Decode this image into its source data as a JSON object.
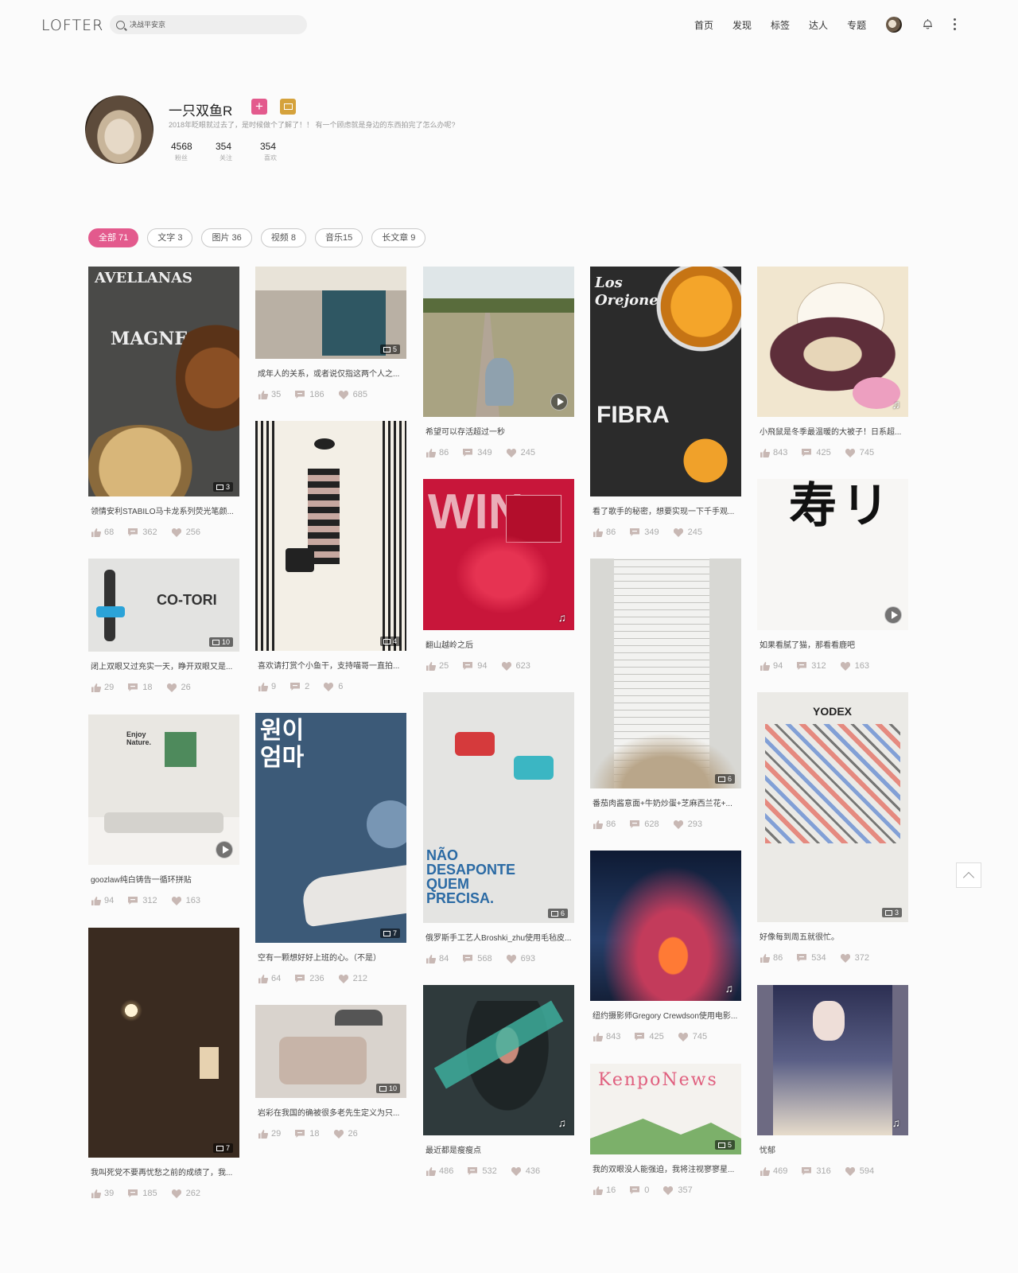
{
  "header": {
    "logo": "LOFTER",
    "search_placeholder": "决战平安京",
    "nav": [
      "首页",
      "发现",
      "标签",
      "达人",
      "专题"
    ]
  },
  "profile": {
    "name": "一只双鱼R",
    "follow_label": "+",
    "bio": "2018年眨眼就过去了，是时候做个了解了！！ 有一个顾虑就是身边的东西拍完了怎么办呢?",
    "stats": [
      {
        "num": "4568",
        "label": "粉丝"
      },
      {
        "num": "354",
        "label": "关注"
      },
      {
        "num": "354",
        "label": "喜欢"
      }
    ]
  },
  "tabs": [
    {
      "label": "全部  71",
      "active": true
    },
    {
      "label": "文字  3"
    },
    {
      "label": "图片 36"
    },
    {
      "label": "视频 8"
    },
    {
      "label": "音乐15"
    },
    {
      "label": "长文章 9"
    }
  ],
  "cards": [
    {
      "title": "领情安利STABILO马卡龙系列荧光笔颜...",
      "likes": "68",
      "comments": "362",
      "hearts": "256",
      "badge": "3",
      "kind": "image",
      "color": "#4a4a48"
    },
    {
      "title": "闭上双眼又过充实一天，睁开双眼又是...",
      "likes": "29",
      "comments": "18",
      "hearts": "26",
      "badge": "10",
      "kind": "image",
      "color": "#e3e3e1"
    },
    {
      "title": "goozlaw纯白铸告一循环拼贴",
      "likes": "94",
      "comments": "312",
      "hearts": "163",
      "kind": "video",
      "color": "#e9e7e2"
    },
    {
      "title": "我叫死党不要再忧愁之前的成绩了，我...",
      "likes": "39",
      "comments": "185",
      "hearts": "262",
      "badge": "7",
      "kind": "image",
      "color": "#3a2b20"
    },
    {
      "title": "成年人的关系，或者说仅指这两个人之...",
      "likes": "35",
      "comments": "186",
      "hearts": "685",
      "badge": "5",
      "kind": "image",
      "color": "#b9b0a4"
    },
    {
      "title": "喜欢请打赏个小鱼干，支持喵哥一直拍...",
      "likes": "9",
      "comments": "2",
      "hearts": "6",
      "badge": "4",
      "kind": "image",
      "color": "#f3efe6"
    },
    {
      "title": "空有一颗想好好上班的心。（不是）",
      "likes": "64",
      "comments": "236",
      "hearts": "212",
      "badge": "7",
      "kind": "image",
      "color": "#3c5a78"
    },
    {
      "title": "岩彩在我国的确被很多老先生定义为只...",
      "likes": "29",
      "comments": "18",
      "hearts": "26",
      "badge": "10",
      "kind": "image",
      "color": "#d9d3cd"
    },
    {
      "title": "希望可以存活超过一秒",
      "likes": "86",
      "comments": "349",
      "hearts": "245",
      "kind": "video",
      "color": "#a9a382"
    },
    {
      "title": "翻山越岭之后",
      "likes": "25",
      "comments": "94",
      "hearts": "623",
      "kind": "music",
      "color": "#c8163a"
    },
    {
      "title": "俄罗斯手工艺人Broshki_zhu使用毛毡皮...",
      "likes": "84",
      "comments": "568",
      "hearts": "693",
      "badge": "6",
      "kind": "image",
      "color": "#e4e4e2"
    },
    {
      "title": "最近都是瘦瘦点",
      "likes": "486",
      "comments": "532",
      "hearts": "436",
      "kind": "music",
      "color": "#2f3a3c"
    },
    {
      "title": "看了歌手的秘密，想要实现一下千手观...",
      "likes": "86",
      "comments": "349",
      "hearts": "245",
      "kind": "none",
      "color": "#2b2b2b"
    },
    {
      "title": "番茄肉酱意面+牛奶炒蛋+芝麻西兰花+...",
      "likes": "86",
      "comments": "628",
      "hearts": "293",
      "badge": "6",
      "kind": "image",
      "color": "#d8d8d4"
    },
    {
      "title": "纽约摄影师Gregory Crewdson使用电影...",
      "likes": "843",
      "comments": "425",
      "hearts": "745",
      "kind": "music",
      "color": "#1b2a46"
    },
    {
      "title": "我的双眼没人能强迫，我将注视寥寥星...",
      "likes": "16",
      "comments": "0",
      "hearts": "357",
      "badge": "5",
      "kind": "image",
      "color": "#f4f2ee"
    },
    {
      "title": "小飛鼠是冬季最温暖的大被子！日系超...",
      "likes": "843",
      "comments": "425",
      "hearts": "745",
      "kind": "music",
      "color": "#f1e6cf"
    },
    {
      "title": "如果看腻了猫，那看看鹿吧",
      "likes": "94",
      "comments": "312",
      "hearts": "163",
      "kind": "video",
      "color": "#f7f6f4"
    },
    {
      "title": "好像每到周五就很忙。",
      "likes": "86",
      "comments": "534",
      "hearts": "372",
      "badge": "3",
      "kind": "image",
      "color": "#ebeae6"
    },
    {
      "title": "忧郁",
      "likes": "469",
      "comments": "316",
      "hearts": "594",
      "kind": "music",
      "color": "#6d6a82"
    }
  ],
  "thumb_texts": {
    "avellanas": "AVELLANAS",
    "magnesio": "MAGNESIO",
    "cotori": "CO-TORI",
    "enjoy": "Enjoy Nature.",
    "korean": "원이 엄마",
    "win": "WIN",
    "nao": "NÃO DESAPONTE QUEM PRECISA.",
    "orejones": "Los Orejones",
    "fibra": "FIBRA",
    "kenpo": "KenpoNews",
    "yodex": "YODEX"
  }
}
